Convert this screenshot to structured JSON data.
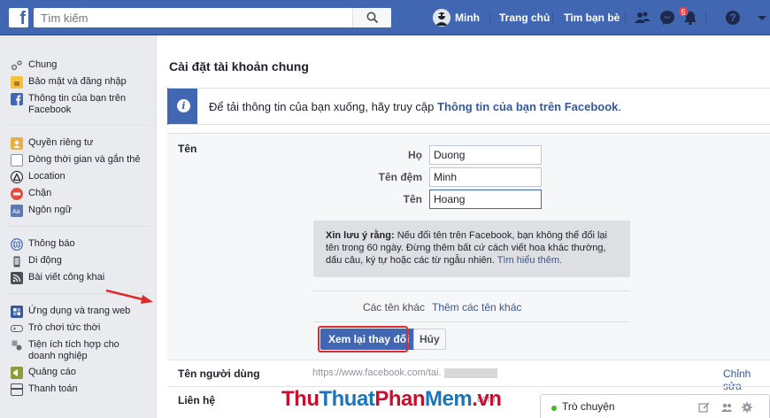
{
  "topbar": {
    "logo": "f",
    "search_placeholder": "Tìm kiếm",
    "user_name": "Minh",
    "home": "Trang chủ",
    "find_friends": "Tìm bạn bè",
    "notification_count": "5",
    "help": "?"
  },
  "sidebar": {
    "groups": [
      [
        {
          "label": "Chung",
          "icon": "gears-icon"
        },
        {
          "label": "Bảo mật và đăng nhập",
          "icon": "lock-icon"
        },
        {
          "label": "Thông tin của bạn trên Facebook",
          "icon": "facebook-icon"
        }
      ],
      [
        {
          "label": "Quyền riêng tư",
          "icon": "privacy-icon"
        },
        {
          "label": "Dòng thời gian và gắn thẻ",
          "icon": "timeline-icon"
        },
        {
          "label": "Location",
          "icon": "location-icon"
        },
        {
          "label": "Chặn",
          "icon": "block-icon"
        },
        {
          "label": "Ngôn ngữ",
          "icon": "language-icon"
        }
      ],
      [
        {
          "label": "Thông báo",
          "icon": "globe-icon"
        },
        {
          "label": "Di động",
          "icon": "mobile-icon"
        },
        {
          "label": "Bài viết công khai",
          "icon": "rss-icon"
        }
      ],
      [
        {
          "label": "Ứng dụng và trang web",
          "icon": "apps-icon"
        },
        {
          "label": "Trò chơi tức thời",
          "icon": "game-icon"
        },
        {
          "label": "Tiện ích tích hợp cho doanh nghiệp",
          "icon": "integration-icon"
        },
        {
          "label": "Quảng cáo",
          "icon": "ads-icon"
        },
        {
          "label": "Thanh toán",
          "icon": "payment-icon"
        }
      ]
    ]
  },
  "main": {
    "title": "Cài đặt tài khoản chung",
    "info_text": "Để tải thông tin của bạn xuống, hãy truy cập ",
    "info_link": "Thông tin của bạn trên Facebook",
    "info_end": ".",
    "name_section": {
      "label": "Tên",
      "last_name_label": "Họ",
      "last_name_value": "Duong",
      "middle_name_label": "Tên đệm",
      "middle_name_value": "Minh",
      "first_name_label": "Tên",
      "first_name_value": "Hoang",
      "note_bold": "Xin lưu ý rằng:",
      "note_text": " Nếu đổi tên trên Facebook, bạn không thể đổi lại tên trong 60 ngày. Đừng thêm bất cứ cách viết hoa khác thường, dấu câu, ký tự hoặc các từ ngẫu nhiên. ",
      "note_link": "Tìm hiểu thêm.",
      "other_names_label": "Các tên khác",
      "other_names_link": "Thêm các tên khác",
      "review_button": "Xem lại thay đổi",
      "cancel_button": "Hủy"
    },
    "username_label": "Tên người dùng",
    "username_value": "https://www.facebook.com/tai.",
    "edit_label": "Chỉnh sửa",
    "contact_label": "Liên hệ",
    "contact_partial": "com",
    "contact_edit_partial": "ửa"
  },
  "watermark": {
    "part1": "Thu",
    "part2": "Thuat",
    "part3": "Phan",
    "part4": "Mem",
    "part5": ".vn"
  },
  "chat": {
    "label": "Trò chuyện"
  },
  "colors": {
    "brand": "#4267b2",
    "highlight": "#e02a2a",
    "link": "#365899"
  }
}
